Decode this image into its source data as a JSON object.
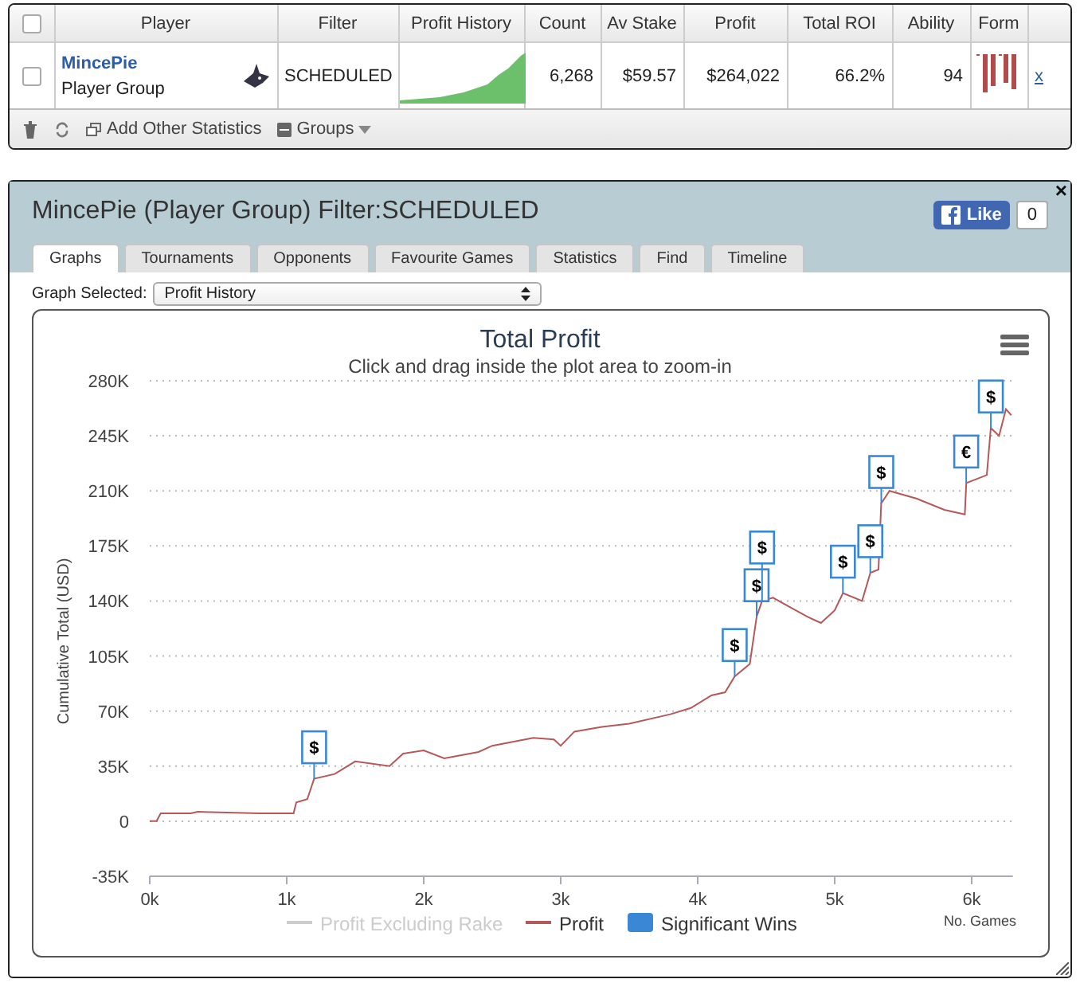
{
  "table": {
    "header_checked": false,
    "columns": [
      "Player",
      "Filter",
      "Profit History",
      "Count",
      "Av Stake",
      "Profit",
      "Total ROI",
      "Ability",
      "Form"
    ],
    "rows": [
      {
        "checked": false,
        "player": "MincePie",
        "group": "Player Group",
        "filter": "SCHEDULED",
        "count": "6,268",
        "av_stake": "$59.57",
        "profit": "$264,022",
        "total_roi": "66.2%",
        "ability": "94",
        "remove": "x"
      }
    ]
  },
  "toolbar": {
    "add_stats": "Add Other Statistics",
    "groups": "Groups"
  },
  "dialog": {
    "title": "MincePie (Player Group) Filter:SCHEDULED",
    "like": "Like",
    "like_count": "0",
    "close": "×",
    "tabs": [
      {
        "label": "Graphs",
        "selected": true
      },
      {
        "label": "Tournaments",
        "selected": false
      },
      {
        "label": "Opponents",
        "selected": false
      },
      {
        "label": "Favourite Games",
        "selected": false
      },
      {
        "label": "Statistics",
        "selected": false
      },
      {
        "label": "Find",
        "selected": false
      },
      {
        "label": "Timeline",
        "selected": false
      }
    ],
    "graph_select": {
      "label": "Graph Selected:",
      "value": "Profit History"
    },
    "chart": {
      "subtitle": "Click and drag inside the plot area to zoom-in",
      "legend": [
        {
          "label": "Profit Excluding Rake",
          "hidden": true,
          "color": "#cccccc"
        }
      ],
      "flag_labels": [
        "$",
        "$",
        "$",
        "$",
        "$",
        "$",
        "$",
        "€",
        "$"
      ],
      "chart_data": {
        "type": "line",
        "title": "Total Profit",
        "xlabel": "No. Games",
        "ylabel": "Cumulative Total (USD)",
        "grid": true,
        "legend": "bottom",
        "x": [
          0,
          50,
          80,
          300,
          350,
          800,
          1050,
          1070,
          1150,
          1200,
          1350,
          1500,
          1750,
          1850,
          2000,
          2150,
          2400,
          2500,
          2800,
          2950,
          3000,
          3100,
          3300,
          3500,
          3800,
          3950,
          4100,
          4200,
          4270,
          4380,
          4430,
          4450,
          4470,
          4550,
          4800,
          4900,
          5000,
          5060,
          5200,
          5260,
          5320,
          5340,
          5400,
          5600,
          5800,
          5950,
          5960,
          6050,
          6110,
          6140,
          6200,
          6250,
          6290
        ],
        "series": [
          {
            "name": "Profit",
            "color": "#b5585a",
            "values": [
              0,
              0,
              5000,
              5000,
              6000,
              5000,
              5000,
              12000,
              14000,
              27000,
              30000,
              38000,
              35000,
              43000,
              45000,
              40000,
              44000,
              48000,
              53000,
              52000,
              48000,
              57000,
              60000,
              62000,
              68000,
              72000,
              80000,
              82000,
              92000,
              100000,
              130000,
              135000,
              140000,
              142000,
              130000,
              126000,
              134000,
              145000,
              140000,
              158000,
              160000,
              202000,
              210000,
              205000,
              198000,
              195000,
              215000,
              218000,
              220000,
              250000,
              245000,
              262000,
              258000
            ]
          },
          {
            "name": "Significant Wins",
            "color": "#3a87d6",
            "marker": "square",
            "values": [
              null,
              null,
              null,
              null,
              null,
              null,
              null,
              null,
              null,
              47000,
              null,
              null,
              null,
              null,
              null,
              null,
              null,
              null,
              null,
              null,
              null,
              null,
              null,
              null,
              null,
              null,
              null,
              null,
              112000,
              null,
              150000,
              null,
              174000,
              null,
              null,
              null,
              null,
              165000,
              null,
              178000,
              null,
              222000,
              null,
              null,
              null,
              null,
              235000,
              null,
              null,
              270000,
              null,
              null,
              null
            ]
          }
        ],
        "xlim": [
          0,
          6300
        ],
        "ylim": [
          -35000,
          280000
        ],
        "xticks": [
          {
            "value": 0,
            "label": "0k"
          },
          {
            "value": 1000,
            "label": "1k"
          },
          {
            "value": 2000,
            "label": "2k"
          },
          {
            "value": 3000,
            "label": "3k"
          },
          {
            "value": 4000,
            "label": "4k"
          },
          {
            "value": 5000,
            "label": "5k"
          },
          {
            "value": 6000,
            "label": "6k"
          }
        ],
        "yticks": [
          {
            "value": -35000,
            "label": "-35K"
          },
          {
            "value": 0,
            "label": "0"
          },
          {
            "value": 35000,
            "label": "35K"
          },
          {
            "value": 70000,
            "label": "70K"
          },
          {
            "value": 105000,
            "label": "105K"
          },
          {
            "value": 140000,
            "label": "140K"
          },
          {
            "value": 175000,
            "label": "175K"
          },
          {
            "value": 210000,
            "label": "210K"
          },
          {
            "value": 245000,
            "label": "245K"
          },
          {
            "value": 280000,
            "label": "280K"
          }
        ]
      }
    }
  }
}
